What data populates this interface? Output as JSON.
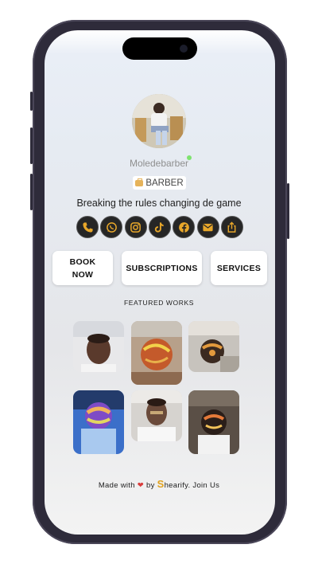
{
  "profile": {
    "username": "Moledebarber",
    "badge": "BARBER",
    "bio": "Breaking the rules changing de game"
  },
  "socials": [
    {
      "icon": "phone-icon"
    },
    {
      "icon": "whatsapp-icon"
    },
    {
      "icon": "instagram-icon"
    },
    {
      "icon": "tiktok-icon"
    },
    {
      "icon": "facebook-icon"
    },
    {
      "icon": "email-icon"
    },
    {
      "icon": "share-icon"
    }
  ],
  "actions": {
    "book_line1": "BOOK",
    "book_line2": "NOW",
    "subscriptions": "SUBSCRIPTIONS",
    "services": "SERVICES"
  },
  "featured_title": "FEATURED WORKS",
  "footer": {
    "made_with": "Made with",
    "by": "by",
    "brand_initial": "S",
    "brand_rest": "hearify.",
    "join": "Join Us"
  },
  "colors": {
    "social_bg": "#262626",
    "brand": "#e0a21f",
    "online": "#7ee36f"
  }
}
